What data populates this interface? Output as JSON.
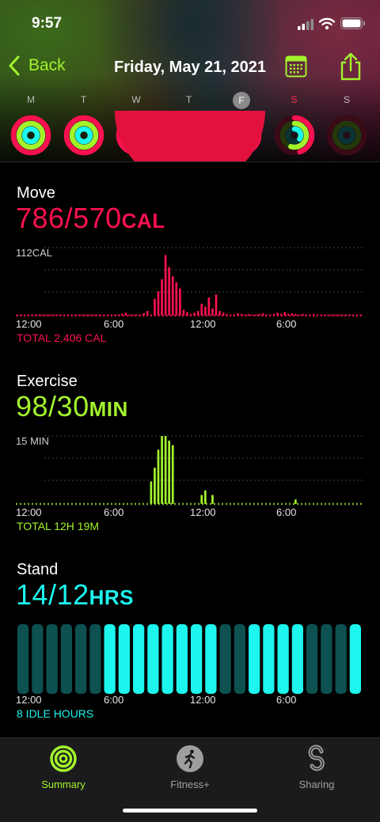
{
  "status_bar": {
    "time": "9:57"
  },
  "nav": {
    "back_label": "Back",
    "title": "Friday, May 21, 2021"
  },
  "colors": {
    "move": "#fa114f",
    "exercise": "#a3f32b",
    "stand": "#1cf6ee",
    "accent": "#a3f32b"
  },
  "week": {
    "days": [
      {
        "letter": "M",
        "selected": false,
        "today": false,
        "move": 1.0,
        "exercise": 1.0,
        "stand": 1.0
      },
      {
        "letter": "T",
        "selected": false,
        "today": false,
        "move": 1.0,
        "exercise": 1.0,
        "stand": 1.0
      },
      {
        "letter": "W",
        "selected": false,
        "today": false,
        "move": 1.0,
        "exercise": 1.0,
        "stand": 1.0
      },
      {
        "letter": "T",
        "selected": false,
        "today": false,
        "move": 1.0,
        "exercise": 1.0,
        "stand": 1.0
      },
      {
        "letter": "F",
        "selected": true,
        "today": false,
        "move": 1.0,
        "exercise": 1.0,
        "stand": 1.0
      },
      {
        "letter": "S",
        "selected": false,
        "today": true,
        "move": 0.45,
        "exercise": 0.55,
        "stand": 0.35
      },
      {
        "letter": "S",
        "selected": false,
        "today": false,
        "move": 0,
        "exercise": 0,
        "stand": 0
      }
    ]
  },
  "move": {
    "title": "Move",
    "value": "786/570",
    "unit": "CAL",
    "scale_label": "112CAL",
    "x_labels": [
      "12:00",
      "6:00",
      "12:00",
      "6:00"
    ],
    "total": "TOTAL 2,406 CAL"
  },
  "exercise": {
    "title": "Exercise",
    "value": "98/30",
    "unit": "MIN",
    "scale_label": "15 MIN",
    "x_labels": [
      "12:00",
      "6:00",
      "12:00",
      "6:00"
    ],
    "total": "TOTAL 12H 19M"
  },
  "stand": {
    "title": "Stand",
    "value": "14/12",
    "unit": "HRS",
    "x_labels": [
      "12:00",
      "6:00",
      "12:00",
      "6:00"
    ],
    "total": "8 IDLE HOURS"
  },
  "chart_data": [
    {
      "type": "bar",
      "name": "move",
      "ymax": 112,
      "x": [
        0,
        1,
        2,
        3,
        4,
        5,
        6,
        7,
        8,
        9,
        10,
        11,
        12,
        13,
        14,
        15,
        16,
        17,
        18,
        19,
        20,
        21,
        22,
        23,
        24,
        25,
        26,
        27,
        28,
        29,
        30,
        31,
        32,
        33,
        34,
        35,
        36,
        37,
        38,
        39,
        40,
        41,
        42,
        43,
        44,
        45,
        46,
        47,
        48,
        49,
        50,
        51,
        52,
        53,
        54,
        55,
        56,
        57,
        58,
        59,
        60,
        61,
        62,
        63,
        64,
        65,
        66,
        67,
        68,
        69,
        70,
        71,
        72,
        73,
        74,
        75,
        76,
        77,
        78,
        79,
        80,
        81,
        82,
        83,
        84,
        85,
        86,
        87,
        88,
        89,
        90,
        91,
        92,
        93,
        94,
        95
      ],
      "values": [
        2,
        2,
        2,
        2,
        2,
        2,
        2,
        2,
        2,
        2,
        2,
        2,
        2,
        2,
        2,
        2,
        2,
        2,
        2,
        2,
        2,
        2,
        2,
        2,
        2,
        2,
        2,
        2,
        2,
        3,
        5,
        2,
        2,
        2,
        2,
        4,
        8,
        2,
        28,
        40,
        60,
        100,
        80,
        65,
        55,
        45,
        10,
        6,
        3,
        5,
        8,
        20,
        15,
        30,
        12,
        35,
        8,
        5,
        3,
        2,
        2,
        4,
        3,
        2,
        3,
        2,
        2,
        3,
        4,
        2,
        2,
        3,
        5,
        3,
        6,
        3,
        4,
        3,
        2,
        3,
        2,
        2,
        3,
        2,
        2,
        2,
        2,
        2,
        2,
        2,
        2,
        2,
        2,
        2,
        2,
        2
      ]
    },
    {
      "type": "bar",
      "name": "exercise",
      "ymax": 15,
      "x": [
        0,
        1,
        2,
        3,
        4,
        5,
        6,
        7,
        8,
        9,
        10,
        11,
        12,
        13,
        14,
        15,
        16,
        17,
        18,
        19,
        20,
        21,
        22,
        23,
        24,
        25,
        26,
        27,
        28,
        29,
        30,
        31,
        32,
        33,
        34,
        35,
        36,
        37,
        38,
        39,
        40,
        41,
        42,
        43,
        44,
        45,
        46,
        47,
        48,
        49,
        50,
        51,
        52,
        53,
        54,
        55,
        56,
        57,
        58,
        59,
        60,
        61,
        62,
        63,
        64,
        65,
        66,
        67,
        68,
        69,
        70,
        71,
        72,
        73,
        74,
        75,
        76,
        77,
        78,
        79,
        80,
        81,
        82,
        83,
        84,
        85,
        86,
        87,
        88,
        89,
        90,
        91,
        92,
        93,
        94,
        95
      ],
      "values": [
        0,
        0,
        0,
        0,
        0,
        0,
        0,
        0,
        0,
        0,
        0,
        0,
        0,
        0,
        0,
        0,
        0,
        0,
        0,
        0,
        0,
        0,
        0,
        0,
        0,
        0,
        0,
        0,
        0,
        0,
        0,
        0,
        0,
        0,
        0,
        0,
        0,
        5,
        8,
        12,
        15,
        15,
        14,
        13,
        0,
        0,
        0,
        0,
        0,
        0,
        0,
        2,
        3,
        0,
        2,
        0,
        0,
        0,
        0,
        0,
        0,
        0,
        0,
        0,
        0,
        0,
        0,
        0,
        0,
        0,
        0,
        0,
        0,
        0,
        0,
        0,
        0,
        1,
        0,
        0,
        0,
        0,
        0,
        0,
        0,
        0,
        0,
        0,
        0,
        0,
        0,
        0,
        0,
        0,
        0,
        0
      ]
    },
    {
      "type": "bar",
      "name": "stand",
      "x": [
        0,
        1,
        2,
        3,
        4,
        5,
        6,
        7,
        8,
        9,
        10,
        11,
        12,
        13,
        14,
        15,
        16,
        17,
        18,
        19,
        20,
        21,
        22,
        23
      ],
      "values": [
        0,
        0,
        0,
        0,
        0,
        0,
        1,
        1,
        1,
        1,
        1,
        1,
        1,
        1,
        0,
        0,
        1,
        1,
        1,
        1,
        0,
        0,
        0,
        1
      ],
      "idle_hours": 8
    }
  ],
  "tabs": [
    {
      "label": "Summary",
      "active": true,
      "icon": "activity-rings-icon"
    },
    {
      "label": "Fitness+",
      "active": false,
      "icon": "running-figure-icon"
    },
    {
      "label": "Sharing",
      "active": false,
      "icon": "sharing-icon"
    }
  ]
}
